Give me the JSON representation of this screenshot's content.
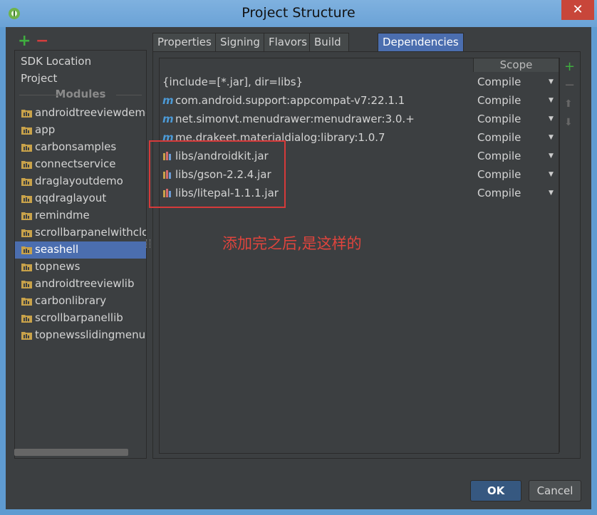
{
  "window": {
    "title": "Project Structure",
    "close_label": "✕"
  },
  "left_toolbar": {
    "add_label": "+",
    "remove_label": "−"
  },
  "left_panel": {
    "top_items": [
      {
        "label": "SDK Location"
      },
      {
        "label": "Project"
      }
    ],
    "modules_header": "Modules",
    "modules": [
      {
        "label": "androidtreeviewdemo"
      },
      {
        "label": "app"
      },
      {
        "label": "carbonsamples"
      },
      {
        "label": "connectservice"
      },
      {
        "label": "draglayoutdemo"
      },
      {
        "label": "qqdraglayout"
      },
      {
        "label": "remindme"
      },
      {
        "label": "scrollbarpanelwithclo"
      },
      {
        "label": "seashell",
        "selected": true
      },
      {
        "label": "topnews"
      },
      {
        "label": "androidtreeviewlib"
      },
      {
        "label": "carbonlibrary"
      },
      {
        "label": "scrollbarpanellib"
      },
      {
        "label": "topnewsslidingmenul"
      }
    ]
  },
  "tabs": [
    {
      "label": "Properties"
    },
    {
      "label": "Signing"
    },
    {
      "label": "Flavors"
    },
    {
      "label": "Build Types"
    },
    {
      "label": "Dependencies",
      "active": true
    }
  ],
  "dependencies": {
    "scope_header": "Scope",
    "rows": [
      {
        "name": "{include=[*.jar], dir=libs}",
        "icon": "none",
        "scope": "Compile"
      },
      {
        "name": "com.android.support:appcompat-v7:22.1.1",
        "icon": "maven",
        "scope": "Compile"
      },
      {
        "name": "net.simonvt.menudrawer:menudrawer:3.0.+",
        "icon": "maven",
        "scope": "Compile"
      },
      {
        "name": "me.drakeet.materialdialog:library:1.0.7",
        "icon": "maven",
        "scope": "Compile"
      },
      {
        "name": "libs/androidkit.jar",
        "icon": "jar",
        "scope": "Compile"
      },
      {
        "name": "libs/gson-2.2.4.jar",
        "icon": "jar",
        "scope": "Compile"
      },
      {
        "name": "libs/litepal-1.1.1.jar",
        "icon": "jar",
        "scope": "Compile"
      }
    ],
    "side_buttons": {
      "add": "+",
      "remove": "−",
      "up": "⬆",
      "down": "⬇"
    },
    "maven_letter": "m"
  },
  "annotation": {
    "text": "添加完之后,是这样的"
  },
  "buttons": {
    "ok": "OK",
    "cancel": "Cancel"
  },
  "colors": {
    "selection": "#4b6eaf",
    "highlight": "#d63a3a",
    "annotation": "#e0443d",
    "add_green": "#3fae3f",
    "remove_red": "#d23d3d"
  }
}
